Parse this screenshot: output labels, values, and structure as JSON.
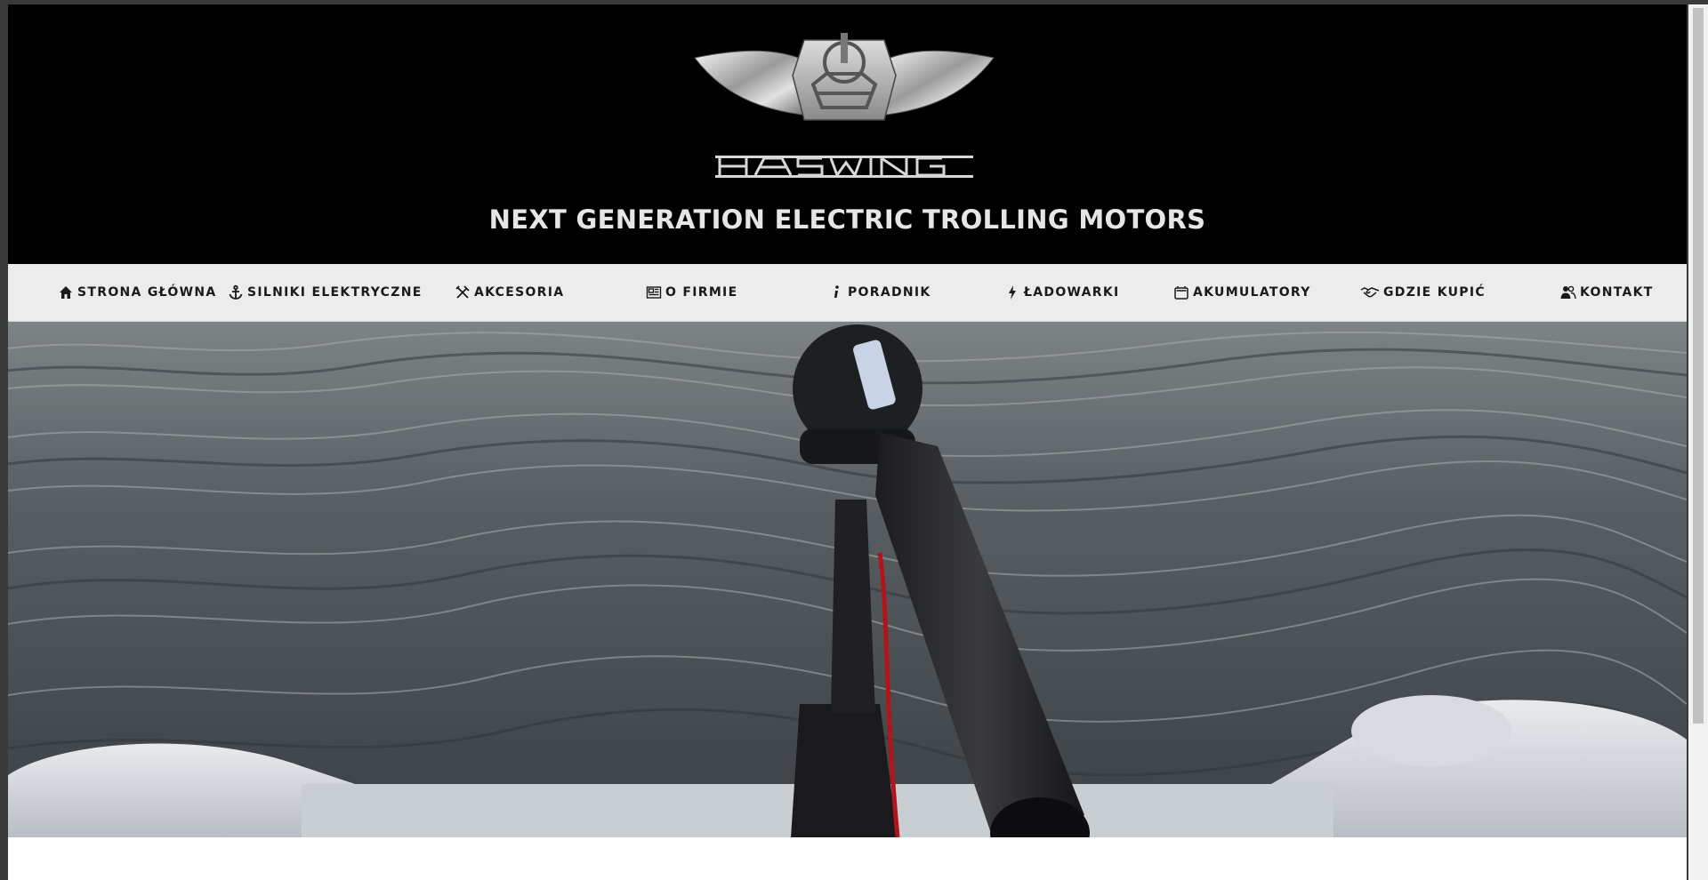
{
  "header": {
    "logo_text": "HASWING",
    "tagline": "NEXT GENERATION ELECTRIC TROLLING MOTORS"
  },
  "nav": {
    "items": [
      {
        "label": "STRONA GŁÓWNA",
        "icon": "home-icon"
      },
      {
        "label": "SILNIKI ELEKTRYCZNE",
        "icon": "anchor-icon"
      },
      {
        "label": "AKCESORIA",
        "icon": "tools-icon"
      },
      {
        "label": "O FIRMIE",
        "icon": "newspaper-icon"
      },
      {
        "label": "PORADNIK",
        "icon": "info-icon"
      },
      {
        "label": "ŁADOWARKI",
        "icon": "bolt-icon"
      },
      {
        "label": "AKUMULATORY",
        "icon": "battery-icon"
      },
      {
        "label": "GDZIE KUPIĆ",
        "icon": "handshake-icon"
      },
      {
        "label": "KONTAKT",
        "icon": "contact-icon"
      }
    ]
  },
  "colors": {
    "header_bg": "#000000",
    "nav_bg": "#ececec",
    "tagline": "#e6e6e6"
  }
}
